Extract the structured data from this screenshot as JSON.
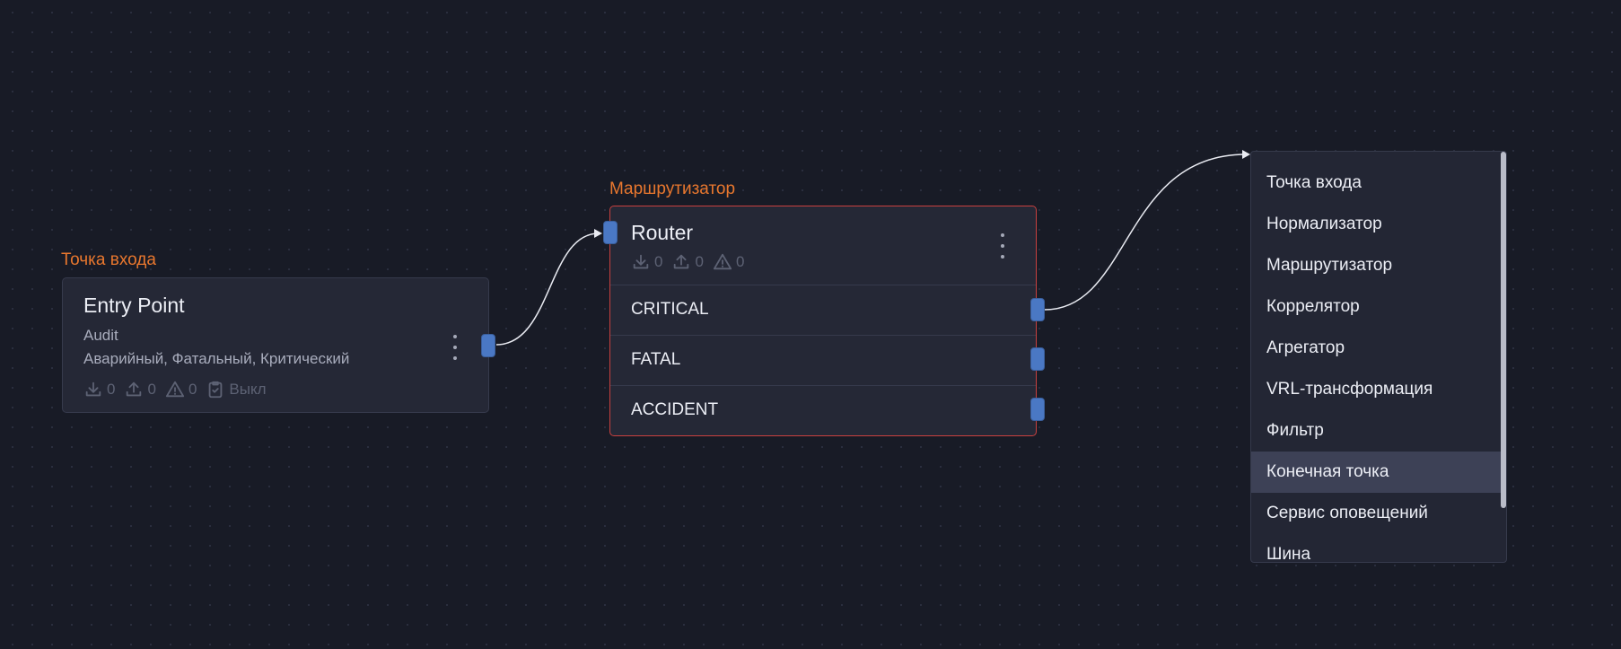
{
  "nodes": {
    "entry": {
      "caption": "Точка входа",
      "title": "Entry Point",
      "subtitle": "Audit",
      "levels": "Аварийный, Фатальный, Критический",
      "stats": {
        "in": "0",
        "out": "0",
        "warn": "0",
        "switch": "Выкл"
      }
    },
    "router": {
      "caption": "Маршрутизатор",
      "title": "Router",
      "stats": {
        "in": "0",
        "out": "0",
        "warn": "0"
      },
      "routes": [
        {
          "label": "CRITICAL"
        },
        {
          "label": "FATAL"
        },
        {
          "label": "ACCIDENT"
        }
      ]
    }
  },
  "menu": {
    "items": [
      {
        "label": "Точка входа"
      },
      {
        "label": "Нормализатор"
      },
      {
        "label": "Маршрутизатор"
      },
      {
        "label": "Коррелятор"
      },
      {
        "label": "Агрегатор"
      },
      {
        "label": "VRL-трансформация"
      },
      {
        "label": "Фильтр"
      },
      {
        "label": "Конечная точка"
      },
      {
        "label": "Сервис оповещений"
      },
      {
        "label": "Шина"
      }
    ],
    "highlighted": "Конечная точка"
  },
  "colors": {
    "background": "#181b26",
    "node": "#252836",
    "caption": "#e8772e",
    "port": "#4a78c4",
    "selected_border": "#c9413f",
    "menu_highlight": "#3d4156"
  }
}
